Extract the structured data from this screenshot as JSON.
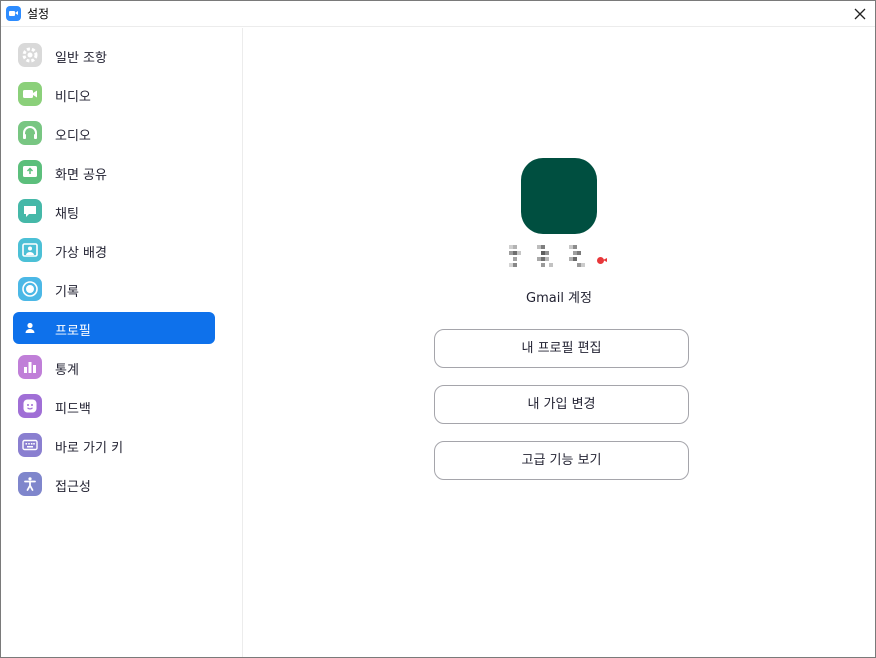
{
  "window": {
    "title": "설정",
    "accent": "#0e71eb"
  },
  "sidebar": {
    "items": [
      {
        "label": "일반 조항",
        "icon": "gear-icon",
        "color": "#d9d9d9",
        "active": false
      },
      {
        "label": "비디오",
        "icon": "video-camera-icon",
        "color": "#8bd07a",
        "active": false
      },
      {
        "label": "오디오",
        "icon": "headphones-icon",
        "color": "#78c682",
        "active": false
      },
      {
        "label": "화면 공유",
        "icon": "share-screen-icon",
        "color": "#5cbf7c",
        "active": false
      },
      {
        "label": "채팅",
        "icon": "chat-bubble-icon",
        "color": "#45b8a8",
        "active": false
      },
      {
        "label": "가상 배경",
        "icon": "virtual-background-icon",
        "color": "#4cc0d6",
        "active": false
      },
      {
        "label": "기록",
        "icon": "record-icon",
        "color": "#4cb8e6",
        "active": false
      },
      {
        "label": "프로필",
        "icon": "person-icon",
        "color": "#0e71eb",
        "active": true
      },
      {
        "label": "통계",
        "icon": "bar-chart-icon",
        "color": "#c07fd8",
        "active": false
      },
      {
        "label": "피드백",
        "icon": "smiley-icon",
        "color": "#a06fd6",
        "active": false
      },
      {
        "label": "바로 가기 키",
        "icon": "keyboard-icon",
        "color": "#8a7fd0",
        "active": false
      },
      {
        "label": "접근성",
        "icon": "accessibility-icon",
        "color": "#7f86cc",
        "active": false
      }
    ]
  },
  "profile": {
    "avatar_color": "#004f40",
    "status_color": "#e8373a",
    "account_type": "Gmail 계정",
    "buttons": {
      "edit_profile": "내 프로필 편집",
      "change_plan": "내 가입 변경",
      "advanced": "고급 기능 보기"
    }
  }
}
